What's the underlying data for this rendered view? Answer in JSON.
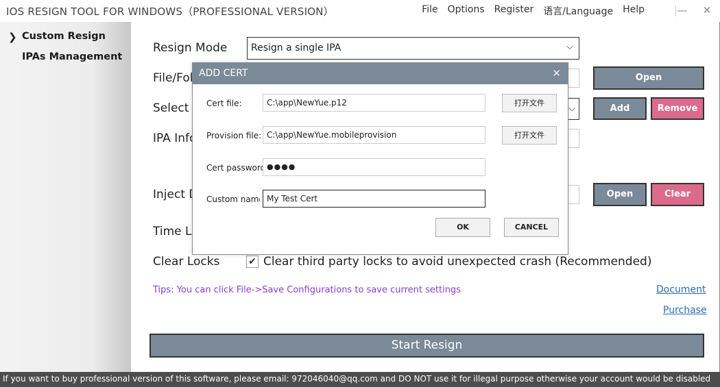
{
  "app": {
    "title": "IOS RESIGN TOOL FOR WINDOWS（PROFESSIONAL VERSION）",
    "menu": [
      "File",
      "Options",
      "Register",
      "语言/Language",
      "Help"
    ],
    "minimize": "—",
    "close": "✕"
  },
  "sidebar": {
    "items": [
      {
        "label": "Custom Resign",
        "selected": true
      },
      {
        "label": "IPAs Management",
        "selected": false
      }
    ],
    "chevron": "❯"
  },
  "main": {
    "resign_mode_label": "Resign Mode",
    "resign_mode_value": "Resign a single IPA",
    "file_label": "File/Fol",
    "select_label": "Select C",
    "ipa_info_label": "IPA Info",
    "inject_label": "Inject D",
    "time_label": "Time Lo",
    "clear_locks_label": "Clear Locks",
    "clear_locks_checkbox": "Clear third party locks to avoid unexpected crash (Recommended)",
    "clear_locks_checked": true,
    "tips": "Tips: You can click File->Save Configurations to save current settings",
    "document_link": "Document",
    "purchase_link": "Purchase",
    "open_button": "Open",
    "add_button": "Add",
    "remove_button": "Remove",
    "inject_open_button": "Open",
    "clear_button": "Clear",
    "start_button": "Start Resign",
    "select_chevron": "⌄"
  },
  "status_bar": "If you want to buy professional version of this software, please email: 972046040@qq.com and DO NOT use it for illegal purpose otherwise your account would be disabled",
  "dialog": {
    "title": "ADD CERT",
    "close": "✕",
    "cert_file_label": "Cert file:",
    "cert_file_value": "C:\\app\\NewYue.p12",
    "cert_open_button": "打开文件",
    "provision_label": "Provision file:",
    "provision_value": "C:\\app\\NewYue.mobileprovision",
    "provision_open_button": "打开文件",
    "password_label": "Cert password",
    "password_value": "●●●●",
    "name_label": "Custom names",
    "name_value": "My Test Cert",
    "ok_button": "OK",
    "cancel_button": "CANCEL"
  },
  "colors": {
    "accent_gray": "#7a8a99",
    "accent_pink": "#dc6a8d",
    "tips_purple": "#8a3ccd",
    "link_blue": "#2c6bb2",
    "status_bg": "#4d4d4d"
  }
}
